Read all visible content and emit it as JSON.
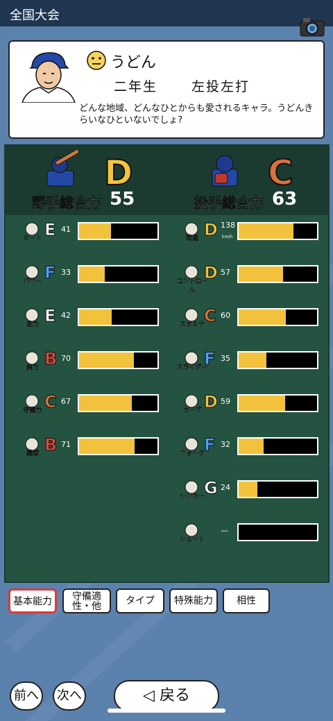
{
  "header": {
    "title": "全国大会"
  },
  "profile": {
    "name": "うどん",
    "grade": "二年生",
    "hand": "左投左打",
    "description": "どんな地域、どんなひとからも愛されるキャラ。うどんきらいなひといないでしょ?"
  },
  "batting": {
    "label": "野手総合力",
    "grade": "D",
    "value": "55"
  },
  "pitching": {
    "label": "投手総合力",
    "grade": "C",
    "value": "63"
  },
  "batting_stats": [
    {
      "label": "ミート",
      "grade": "E",
      "value": "41",
      "level": 0.41,
      "grade_color": "#ffffff"
    },
    {
      "label": "パワー",
      "grade": "F",
      "value": "33",
      "level": 0.33,
      "grade_color": "#4aa3ff"
    },
    {
      "label": "走力",
      "grade": "E",
      "value": "42",
      "level": 0.42,
      "grade_color": "#ffffff"
    },
    {
      "label": "肩力",
      "grade": "B",
      "value": "70",
      "level": 0.7,
      "grade_color": "#e8453c"
    },
    {
      "label": "守備力",
      "grade": "C",
      "value": "67",
      "level": 0.67,
      "grade_color": "#d9733a"
    },
    {
      "label": "捕球",
      "grade": "B",
      "value": "71",
      "level": 0.71,
      "grade_color": "#e8453c"
    }
  ],
  "pitching_stats": [
    {
      "label": "球速",
      "grade": "D",
      "value": "138",
      "unit": "km/h",
      "level": 0.7,
      "grade_color": "#f2c23c"
    },
    {
      "label": "コントロール",
      "grade": "D",
      "value": "57",
      "unit": "",
      "level": 0.57,
      "grade_color": "#f2c23c"
    },
    {
      "label": "スタミナ",
      "grade": "C",
      "value": "60",
      "unit": "",
      "level": 0.6,
      "grade_color": "#d9733a"
    },
    {
      "label": "スライダー",
      "grade": "F",
      "value": "35",
      "unit": "",
      "level": 0.35,
      "grade_color": "#4aa3ff"
    },
    {
      "label": "カーブ",
      "grade": "D",
      "value": "59",
      "unit": "",
      "level": 0.59,
      "grade_color": "#f2c23c"
    },
    {
      "label": "フォーク",
      "grade": "F",
      "value": "32",
      "unit": "",
      "level": 0.32,
      "grade_color": "#4aa3ff"
    },
    {
      "label": "シンカー",
      "grade": "G",
      "value": "24",
      "unit": "",
      "level": 0.24,
      "grade_color": "#ffffff"
    },
    {
      "label": "シュート",
      "grade": "",
      "value": "—",
      "unit": "",
      "level": 0,
      "grade_color": "#ffffff"
    }
  ],
  "tabs": [
    {
      "label": "基本能力",
      "active": true
    },
    {
      "label": "守備適性・他",
      "active": false
    },
    {
      "label": "タイプ",
      "active": false
    },
    {
      "label": "特殊能力",
      "active": false
    },
    {
      "label": "相性",
      "active": false
    }
  ],
  "nav": {
    "prev": "前へ",
    "next": "次へ",
    "back": "◁ 戻る"
  },
  "colors": {
    "bar_fill": "#f2c23c",
    "board": "#245342",
    "background": "#5b81ad",
    "active_tab": "#d93b3b"
  }
}
